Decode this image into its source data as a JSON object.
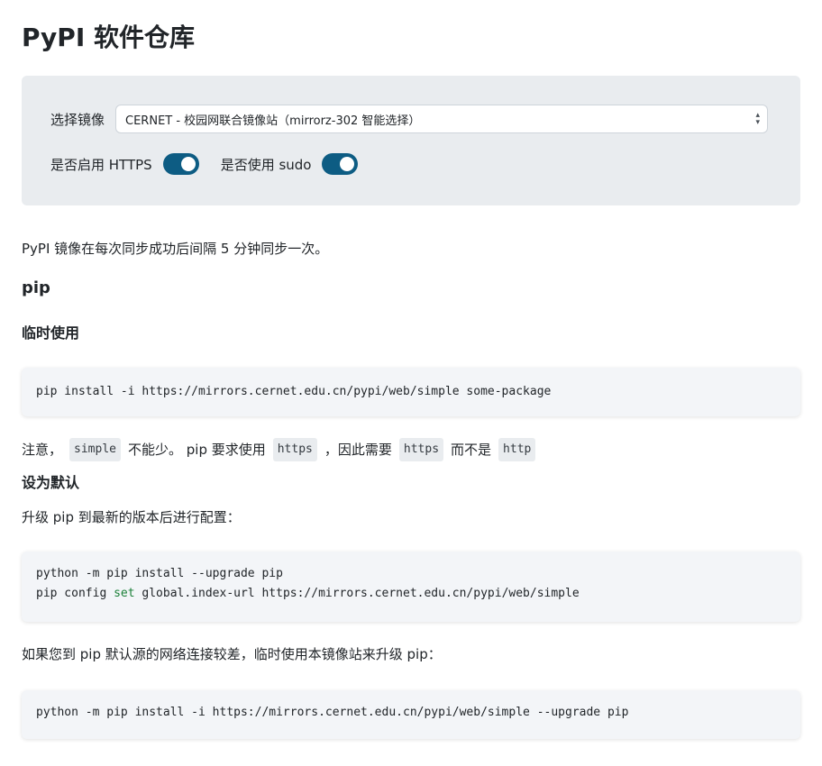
{
  "title": "PyPI 软件仓库",
  "config": {
    "mirror_label": "选择镜像",
    "mirror_value": "CERNET - 校园网联合镜像站（mirrorz-302 智能选择）",
    "https_label": "是否启用 HTTPS",
    "https_on": true,
    "sudo_label": "是否使用 sudo",
    "sudo_on": true,
    "accent": "#0d5c83"
  },
  "intro": "PyPI 镜像在每次同步成功后间隔 5 分钟同步一次。",
  "pip_heading": "pip",
  "temp_heading": "临时使用",
  "temp_code": "pip install -i https://mirrors.cernet.edu.cn/pypi/web/simple some-package",
  "note": {
    "t1": "注意，",
    "c1": "simple",
    "t2": "不能少。 pip 要求使用",
    "c2": "https",
    "t3": "，因此需要",
    "c3": "https",
    "t4": "而不是",
    "c4": "http"
  },
  "default_heading": "设为默认",
  "upgrade_text": "升级 pip 到最新的版本后进行配置：",
  "default_code": {
    "line1": "python -m pip install --upgrade pip",
    "line2_a": "pip config ",
    "line2_kw": "set",
    "line2_b": " global.index-url https://mirrors.cernet.edu.cn/pypi/web/simple"
  },
  "slow_text": "如果您到 pip 默认源的网络连接较差，临时使用本镜像站来升级 pip：",
  "slow_code": "python -m pip install -i https://mirrors.cernet.edu.cn/pypi/web/simple --upgrade pip"
}
